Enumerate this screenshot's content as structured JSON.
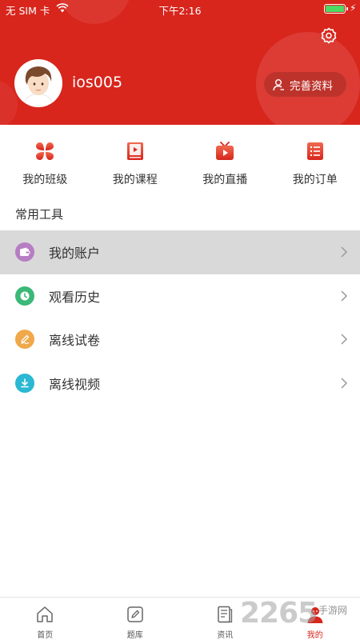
{
  "status_bar": {
    "carrier": "无 SIM 卡",
    "time": "下午2:16"
  },
  "profile": {
    "username": "ios005",
    "complete_profile_label": "完善资料"
  },
  "quick_nav": [
    {
      "label": "我的班级",
      "icon": "clover-icon"
    },
    {
      "label": "我的课程",
      "icon": "book-icon"
    },
    {
      "label": "我的直播",
      "icon": "tv-play-icon"
    },
    {
      "label": "我的订单",
      "icon": "order-list-icon"
    }
  ],
  "tools": {
    "title": "常用工具",
    "items": [
      {
        "label": "我的账户",
        "icon": "wallet-icon",
        "color": "#b77dc4"
      },
      {
        "label": "观看历史",
        "icon": "clock-icon",
        "color": "#3cb878"
      },
      {
        "label": "离线试卷",
        "icon": "pen-icon",
        "color": "#f0a84a"
      },
      {
        "label": "离线视频",
        "icon": "download-icon",
        "color": "#2ab8d2"
      }
    ]
  },
  "tab_bar": {
    "tabs": [
      {
        "label": "首页",
        "icon": "home-icon"
      },
      {
        "label": "题库",
        "icon": "edit-icon"
      },
      {
        "label": "资讯",
        "icon": "news-icon"
      },
      {
        "label": "我的",
        "icon": "user-icon"
      }
    ],
    "active_index": 3
  },
  "watermark": {
    "number": "2265",
    "text": "手游网"
  },
  "colors": {
    "brand_red": "#d8261d",
    "active_row_bg": "#d9d9d9"
  }
}
